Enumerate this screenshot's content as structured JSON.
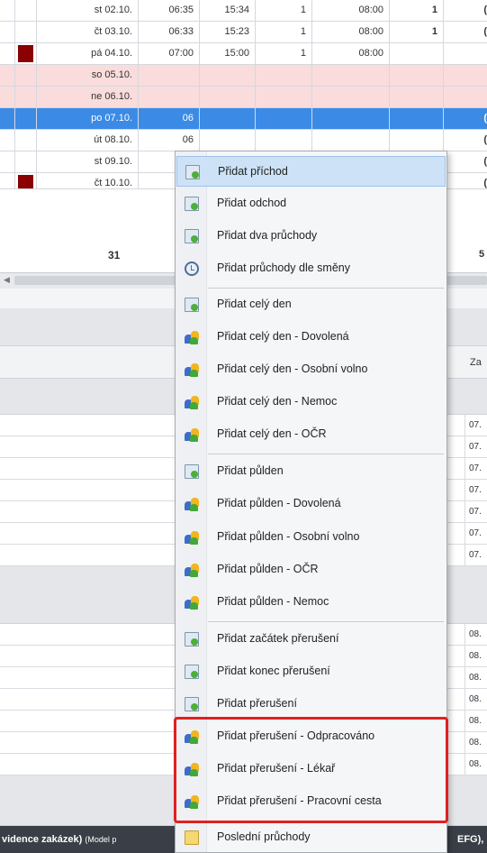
{
  "attendance_rows": [
    {
      "date": "st 02.10.",
      "in": "06:35",
      "out": "15:34",
      "count": "1",
      "fund": "08:00",
      "c7": "1",
      "c8": "(",
      "flag": false,
      "weekend": false,
      "selected": false
    },
    {
      "date": "čt 03.10.",
      "in": "06:33",
      "out": "15:23",
      "count": "1",
      "fund": "08:00",
      "c7": "1",
      "c8": "(",
      "flag": false,
      "weekend": false,
      "selected": false
    },
    {
      "date": "pá 04.10.",
      "in": "07:00",
      "out": "15:00",
      "count": "1",
      "fund": "08:00",
      "c7": "",
      "c8": "",
      "flag": true,
      "weekend": false,
      "selected": false
    },
    {
      "date": "so 05.10.",
      "in": "",
      "out": "",
      "count": "",
      "fund": "",
      "c7": "",
      "c8": "",
      "flag": false,
      "weekend": true,
      "selected": false
    },
    {
      "date": "ne 06.10.",
      "in": "",
      "out": "",
      "count": "",
      "fund": "",
      "c7": "",
      "c8": "",
      "flag": false,
      "weekend": true,
      "selected": false
    },
    {
      "date": "po 07.10.",
      "in": "06",
      "out": "",
      "count": "",
      "fund": "",
      "c7": "",
      "c8": "(",
      "flag": false,
      "weekend": false,
      "selected": true
    },
    {
      "date": "út 08.10.",
      "in": "06",
      "out": "",
      "count": "",
      "fund": "",
      "c7": "",
      "c8": "(",
      "flag": false,
      "weekend": false,
      "selected": false
    },
    {
      "date": "st 09.10.",
      "in": "06",
      "out": "",
      "count": "",
      "fund": "",
      "c7": "",
      "c8": "(",
      "flag": false,
      "weekend": false,
      "selected": false
    },
    {
      "date": "čt 10.10.",
      "in": "06",
      "out": "",
      "count": "",
      "fund": "",
      "c7": "",
      "c8": "(",
      "flag": true,
      "weekend": false,
      "selected": false
    }
  ],
  "totals": {
    "days": "31",
    "right": "5"
  },
  "lower_grid": {
    "header_label": "Za",
    "group1_values": [
      "07.",
      "07.",
      "07.",
      "07.",
      "07.",
      "07.",
      "07."
    ],
    "group2_values": [
      "08.",
      "08.",
      "08.",
      "08.",
      "08.",
      "08.",
      "08."
    ]
  },
  "statusbar": {
    "left_bold": "vidence zakázek)",
    "left_sub": "(Model p",
    "right": "EFG),"
  },
  "context_menu": {
    "items": [
      {
        "label": "Přidat příchod",
        "icon": "doc-add-icon",
        "highlighted": true
      },
      {
        "label": "Přidat odchod",
        "icon": "doc-add-icon"
      },
      {
        "label": "Přidat dva průchody",
        "icon": "doc-add-icon"
      },
      {
        "label": "Přidat průchody dle směny",
        "icon": "clock-icon"
      },
      {
        "label": "Přidat celý den",
        "icon": "doc-add-icon"
      },
      {
        "label": "Přidat celý den - Dovolená",
        "icon": "people-icon"
      },
      {
        "label": "Přidat celý den - Osobní volno",
        "icon": "people-icon"
      },
      {
        "label": "Přidat celý den - Nemoc",
        "icon": "people-icon"
      },
      {
        "label": "Přidat celý den - OČR",
        "icon": "people-icon"
      },
      {
        "label": "Přidat půlden",
        "icon": "doc-add-icon"
      },
      {
        "label": "Přidat půlden - Dovolená",
        "icon": "people-icon"
      },
      {
        "label": "Přidat půlden - Osobní volno",
        "icon": "people-icon"
      },
      {
        "label": "Přidat půlden - OČR",
        "icon": "people-icon"
      },
      {
        "label": "Přidat půlden - Nemoc",
        "icon": "people-icon"
      },
      {
        "label": "Přidat začátek přerušení",
        "icon": "doc-add-icon"
      },
      {
        "label": "Přidat konec přerušení",
        "icon": "doc-add-icon"
      },
      {
        "label": "Přidat přerušení",
        "icon": "doc-add-icon"
      },
      {
        "label": "Přidat přerušení - Odpracováno",
        "icon": "people-icon"
      },
      {
        "label": "Přidat přerušení - Lékař",
        "icon": "people-icon"
      },
      {
        "label": "Přidat přerušení - Pracovní cesta",
        "icon": "people-icon"
      },
      {
        "label": "Poslední průchody",
        "icon": "folder-icon"
      }
    ]
  },
  "colors": {
    "selection": "#3b8be6",
    "weekend": "#fadcdc",
    "flag": "#8b0000",
    "menu_highlight": "#cde2f7",
    "annotation_box": "#e02020"
  }
}
